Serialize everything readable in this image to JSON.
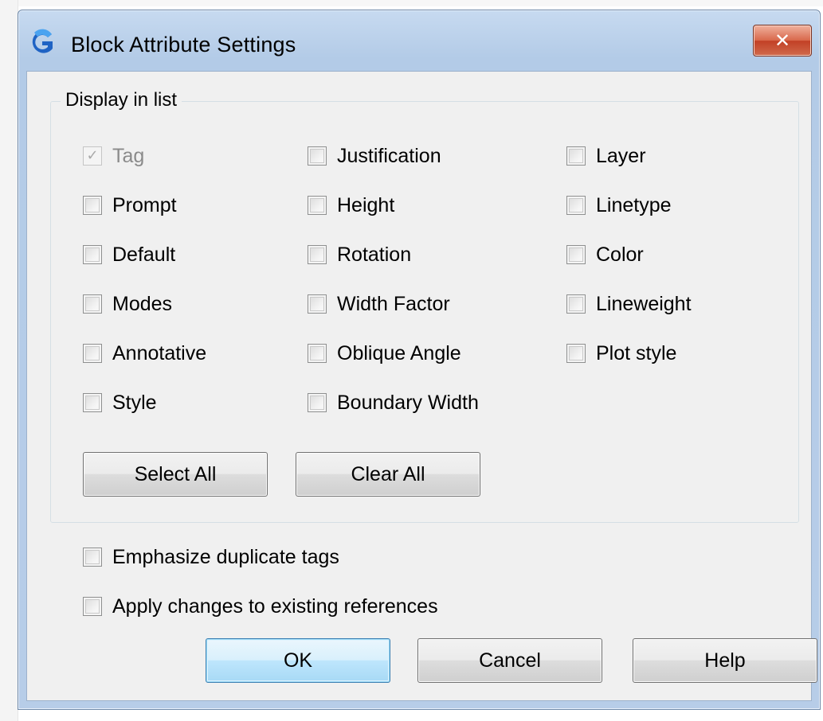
{
  "window": {
    "title": "Block Attribute Settings",
    "close_glyph": "✕"
  },
  "display_group": {
    "title": "Display in list",
    "columns": [
      [
        {
          "label": "Tag",
          "checked": true,
          "disabled": true
        },
        {
          "label": "Prompt",
          "checked": false
        },
        {
          "label": "Default",
          "checked": false
        },
        {
          "label": "Modes",
          "checked": false
        },
        {
          "label": "Annotative",
          "checked": false
        },
        {
          "label": "Style",
          "checked": false
        }
      ],
      [
        {
          "label": "Justification",
          "checked": false
        },
        {
          "label": "Height",
          "checked": false
        },
        {
          "label": "Rotation",
          "checked": false
        },
        {
          "label": "Width Factor",
          "checked": false
        },
        {
          "label": "Oblique Angle",
          "checked": false
        },
        {
          "label": "Boundary Width",
          "checked": false
        }
      ],
      [
        {
          "label": "Layer",
          "checked": false
        },
        {
          "label": "Linetype",
          "checked": false
        },
        {
          "label": "Color",
          "checked": false
        },
        {
          "label": "Lineweight",
          "checked": false
        },
        {
          "label": "Plot style",
          "checked": false
        }
      ]
    ],
    "select_all_label": "Select All",
    "clear_all_label": "Clear All"
  },
  "options": {
    "emphasize_label": "Emphasize duplicate tags",
    "emphasize_checked": false,
    "apply_label": "Apply changes to existing references",
    "apply_checked": false
  },
  "footer": {
    "ok_label": "OK",
    "cancel_label": "Cancel",
    "help_label": "Help"
  },
  "icons": {
    "app": "gstarcad-logo-icon",
    "close": "close-icon",
    "check": "✓"
  },
  "colors": {
    "title_bar": "#b7cde8",
    "close_button": "#c24025",
    "dialog_background": "#f0f0f0",
    "default_button_border": "#3c7fb1"
  }
}
